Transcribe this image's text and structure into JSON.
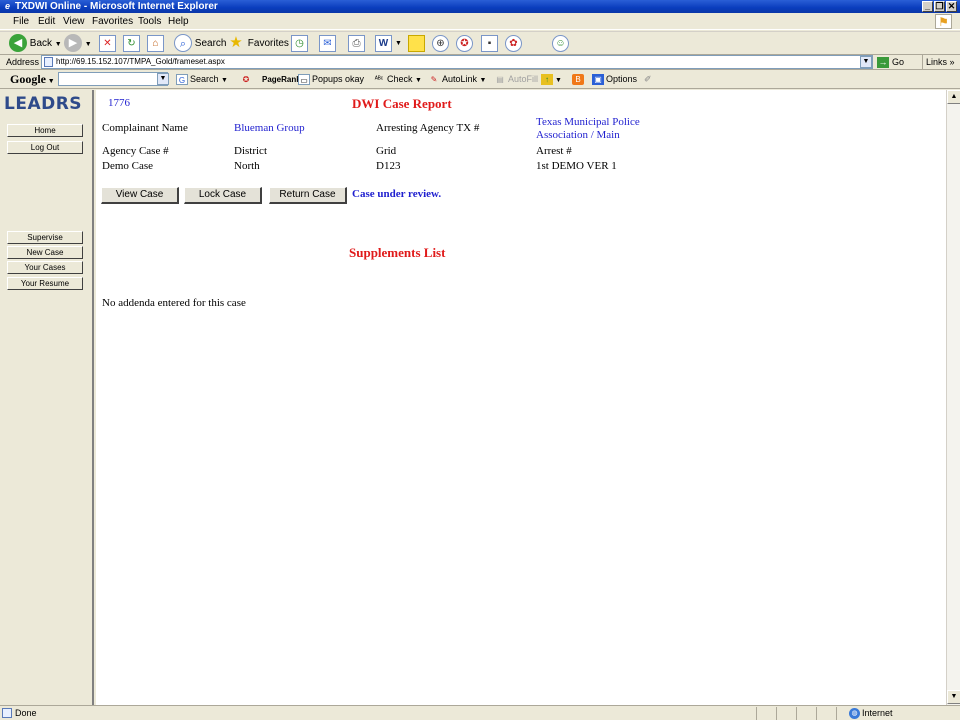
{
  "window": {
    "title": "TXDWI Online - Microsoft Internet Explorer",
    "minimize_glyph": "_",
    "restore_glyph": "❐",
    "close_glyph": "✕"
  },
  "menu": [
    "File",
    "Edit",
    "View",
    "Favorites",
    "Tools",
    "Help"
  ],
  "toolbar": {
    "back": "Back",
    "search": "Search",
    "favorites": "Favorites"
  },
  "address": {
    "label": "Address",
    "url": "http://69.15.152.107/TMPA_Gold/frameset.aspx",
    "go": "Go",
    "links": "Links"
  },
  "googlebar": {
    "logo": "Google",
    "search": "Search",
    "pagerank": "PageRank",
    "popups": "Popups okay",
    "check": "Check",
    "autolink": "AutoLink",
    "autofill": "AutoFill",
    "options": "Options"
  },
  "sidebar": {
    "logo": "LEADRS",
    "items_top": [
      "Home",
      "Log Out"
    ],
    "items_bottom": [
      "Supervise",
      "New Case",
      "Your Cases",
      "Your Resume"
    ]
  },
  "report": {
    "case_number": "1776",
    "title": "DWI Case Report",
    "complainant_label": "Complainant Name",
    "complainant_value": "Blueman Group",
    "arresting_agency_label": "Arresting Agency TX #",
    "arresting_agency_value_line1": "Texas Municipal Police",
    "arresting_agency_value_line2": "Association / Main",
    "agency_case_label": "Agency Case #",
    "district_label": "District",
    "grid_label": "Grid",
    "arrest_label": "Arrest #",
    "agency_case_value": "Demo Case",
    "district_value": "North",
    "grid_value": "D123",
    "arrest_value": "1st DEMO VER 1",
    "buttons": [
      "View Case",
      "Lock Case",
      "Return Case"
    ],
    "status": "Case under review.",
    "supplements_title": "Supplements List",
    "supplements_empty": "No addenda entered for this case"
  },
  "status": {
    "left": "Done",
    "zone": "Internet"
  },
  "colors": {
    "link_blue": "#1f1fcf",
    "heading_red": "#e01a1a",
    "logo_blue": "#2e4a8a"
  }
}
